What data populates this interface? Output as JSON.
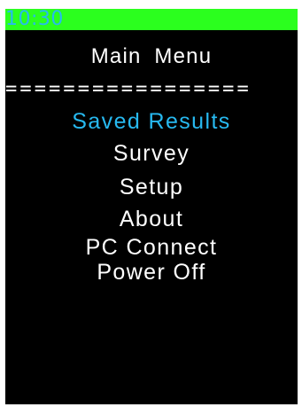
{
  "status_bar": {
    "time": "10:30",
    "background_color": "#2bff1e",
    "time_color": "#27b9f0"
  },
  "header": {
    "title": "Main  Menu"
  },
  "divider": {
    "text": "================="
  },
  "menu": {
    "selected_index": 0,
    "selected_color": "#27b9f0",
    "text_color": "#ffffff",
    "items": [
      {
        "label": "Saved Results"
      },
      {
        "label": "Survey"
      },
      {
        "label": "Setup"
      },
      {
        "label": "About"
      },
      {
        "label": "PC Connect"
      },
      {
        "label": "Power Off"
      }
    ]
  }
}
